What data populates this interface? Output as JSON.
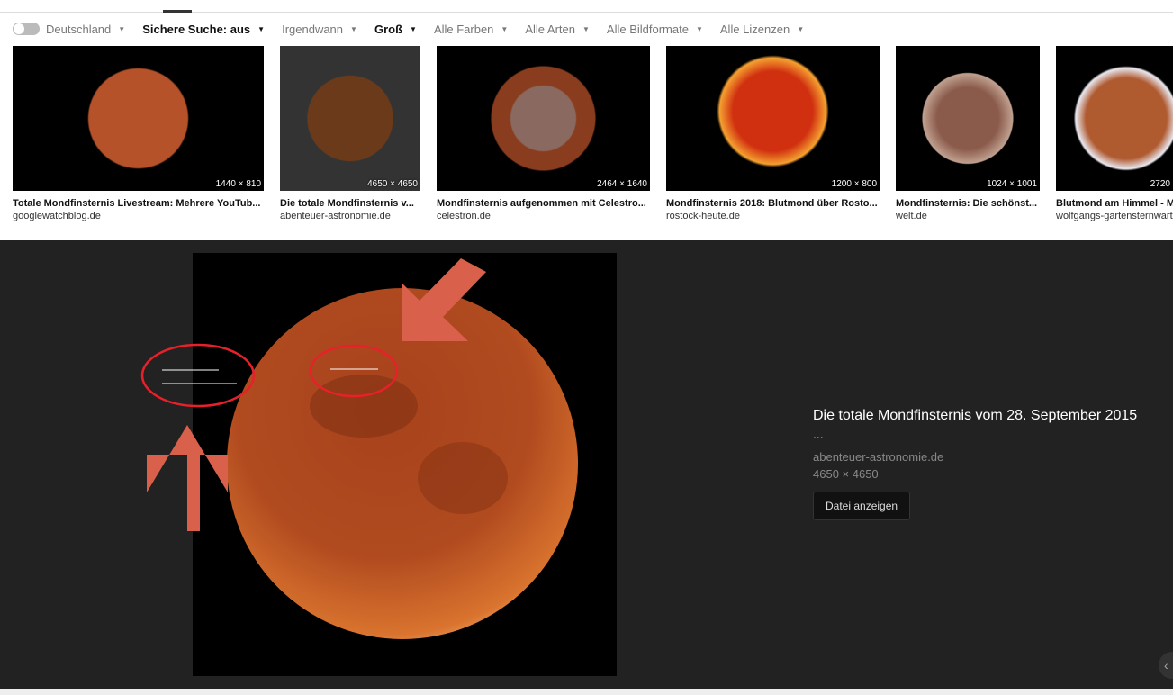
{
  "filters": [
    {
      "label": "Deutschland",
      "bold": false
    },
    {
      "label": "Sichere Suche: aus",
      "bold": true
    },
    {
      "label": "Irgendwann",
      "bold": false
    },
    {
      "label": "Groß",
      "bold": true
    },
    {
      "label": "Alle Farben",
      "bold": false
    },
    {
      "label": "Alle Arten",
      "bold": false
    },
    {
      "label": "Alle Bildformate",
      "bold": false
    },
    {
      "label": "Alle Lizenzen",
      "bold": false
    }
  ],
  "results": [
    {
      "title": "Totale Mondfinsternis Livestream: Mehrere YouTub...",
      "source": "googlewatchblog.de",
      "dims": "1440 × 810"
    },
    {
      "title": "Die totale Mondfinsternis v...",
      "source": "abenteuer-astronomie.de",
      "dims": "4650 × 4650"
    },
    {
      "title": "Mondfinsternis aufgenommen mit Celestro...",
      "source": "celestron.de",
      "dims": "2464 × 1640"
    },
    {
      "title": "Mondfinsternis 2018: Blutmond über Rosto...",
      "source": "rostock-heute.de",
      "dims": "1200 × 800"
    },
    {
      "title": "Mondfinsternis: Die schönst...",
      "source": "welt.de",
      "dims": "1024 × 1001"
    },
    {
      "title": "Blutmond am Himmel - M",
      "source": "wolfgangs-gartensternwart",
      "dims": "2720"
    }
  ],
  "detail": {
    "title": "Die totale Mondfinsternis vom 28. September 2015",
    "more": "...",
    "source": "abenteuer-astronomie.de",
    "dims": "4650 × 4650",
    "button": "Datei anzeigen",
    "annotation_color": "#d9604a",
    "circle_color": "#e8202a"
  },
  "nav": {
    "prev": "‹"
  }
}
